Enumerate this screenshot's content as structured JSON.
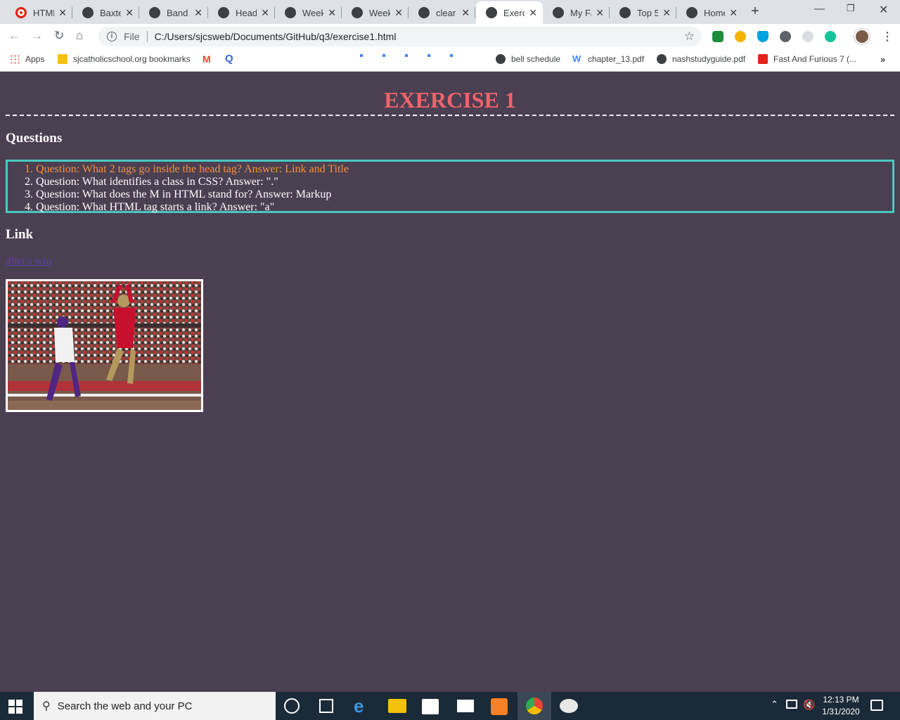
{
  "browser": {
    "tabs": [
      {
        "label": "HTML",
        "icon": "opera-icon",
        "active": false
      },
      {
        "label": "Baxter",
        "icon": "globe-icon",
        "active": false
      },
      {
        "label": "Band",
        "icon": "globe-icon",
        "active": false
      },
      {
        "label": "Headi",
        "icon": "globe-icon",
        "active": false
      },
      {
        "label": "Week",
        "icon": "globe-icon",
        "active": false
      },
      {
        "label": "Week",
        "icon": "globe-icon",
        "active": false
      },
      {
        "label": "clear",
        "icon": "globe-icon",
        "active": false
      },
      {
        "label": "Exerc",
        "icon": "globe-icon",
        "active": true
      },
      {
        "label": "My Fa",
        "icon": "globe-icon",
        "active": false
      },
      {
        "label": "Top 5",
        "icon": "globe-icon",
        "active": false
      },
      {
        "label": "Home",
        "icon": "globe-icon",
        "active": false
      }
    ],
    "address": {
      "scheme_label": "File",
      "url": "C:/Users/sjcsweb/Documents/GitHub/q3/exercise1.html"
    },
    "bookmarks": [
      {
        "label": "Apps"
      },
      {
        "label": "sjcatholicschool.org bookmarks"
      },
      {
        "label": "bell schedule"
      },
      {
        "label": "chapter_13.pdf"
      },
      {
        "label": "nashstudyguide.pdf"
      },
      {
        "label": "Fast And Furious 7 (..."
      }
    ]
  },
  "page": {
    "title": "EXERCISE 1",
    "questions_heading": "Questions",
    "questions": [
      "Question: What 2 tags go inside the head tag? Answer: Link and Title",
      "Question: What identifies a class in CSS? Answer: \".\"",
      "Question: What does the M in HTML stand for? Answer: Markup",
      "Question: What HTML tag starts a link? Answer: \"a\""
    ],
    "link_heading": "Link",
    "link_text": "49er's win",
    "colors": {
      "background": "#4b3f52",
      "title": "#f0646b",
      "first_question": "#f5923e",
      "box_border": "#48c9c0",
      "link": "#5b3fa6"
    }
  },
  "taskbar": {
    "search_placeholder": "Search the web and your PC",
    "time": "12:13 PM",
    "date": "1/31/2020"
  }
}
